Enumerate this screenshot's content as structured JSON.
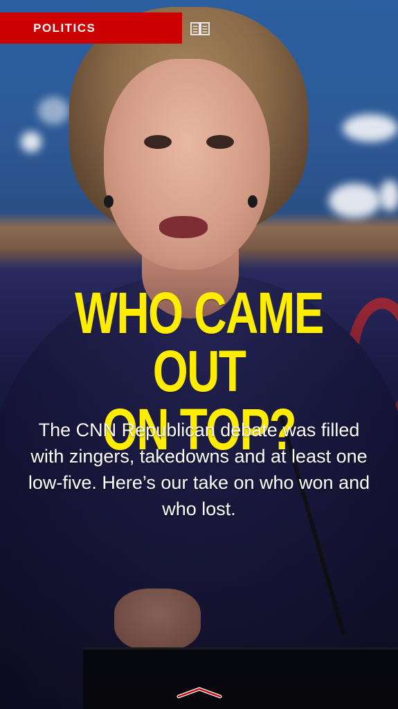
{
  "section": {
    "label": "POLITICS",
    "color": "#cc0000"
  },
  "icons": {
    "read": "book-open-icon",
    "swipe": "chevron-up-icon"
  },
  "headline": {
    "line1": "WHO CAME OUT",
    "line2": "ON TOP?",
    "color": "#ffed00"
  },
  "summary": "The CNN Republican debate was filled with zingers, takedowns and at least one low-five. Here’s our take on who won and who lost."
}
